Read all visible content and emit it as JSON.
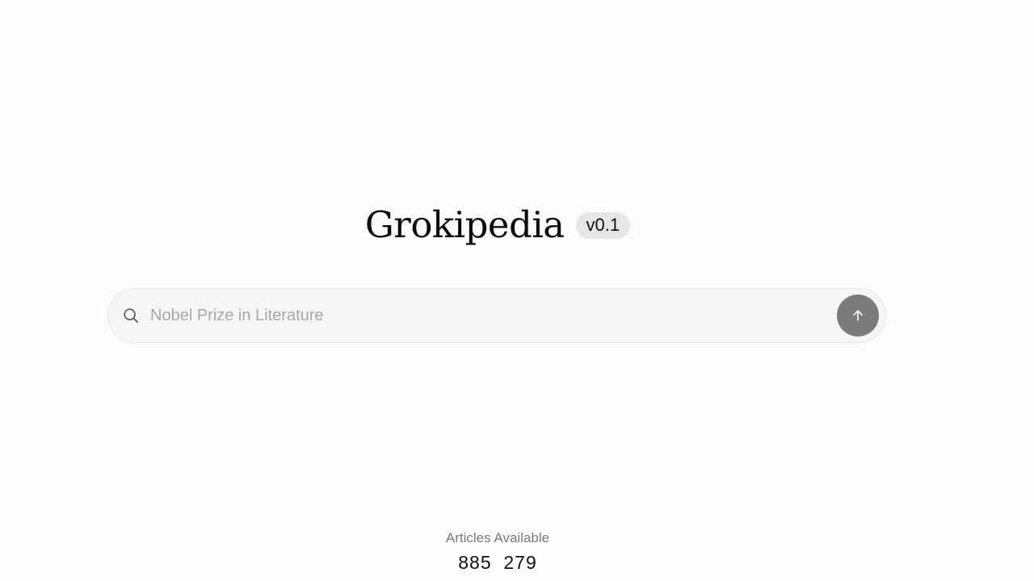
{
  "header": {
    "title": "Grokipedia",
    "version": "v0.1"
  },
  "search": {
    "placeholder": "Nobel Prize in Literature",
    "value": "",
    "icon": "search-icon",
    "submit_icon": "arrow-up-icon"
  },
  "stats": {
    "label": "Articles Available",
    "count": "885  279"
  },
  "colors": {
    "background": "#fcfcfc",
    "submit_button": "#7b7b7b",
    "badge_background": "#e6e6e6"
  }
}
